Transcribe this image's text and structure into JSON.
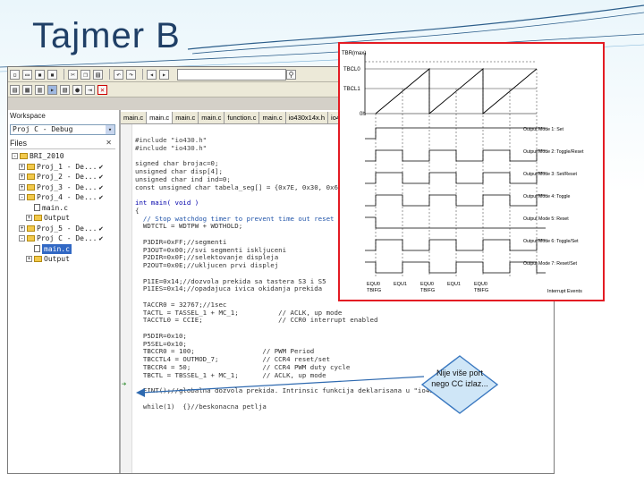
{
  "slide": {
    "title": "Tajmer B"
  },
  "ide": {
    "toolbar1_icons": [
      "new-file-icon",
      "open-icon",
      "save-icon",
      "save-all-icon",
      "cut-icon",
      "copy-icon",
      "paste-icon",
      "undo-icon",
      "redo-icon",
      "find-icon",
      "back-icon",
      "forward-icon"
    ],
    "toolbar2_icons": [
      "compile-icon",
      "make-icon",
      "rebuild-icon",
      "debug-icon",
      "stop-icon"
    ],
    "workspace": {
      "label": "Workspace",
      "config_value": "Proj C - Debug",
      "files_label": "Files",
      "tree": [
        {
          "name": "BRI_2010",
          "indent": 0,
          "type": "folder",
          "check": "",
          "expanded": "-",
          "selected": false
        },
        {
          "name": "Proj_1 - De...",
          "indent": 1,
          "type": "folder",
          "check": "✔",
          "expanded": "+",
          "selected": false
        },
        {
          "name": "Proj_2 - De...",
          "indent": 1,
          "type": "folder",
          "check": "✔",
          "expanded": "+",
          "selected": false
        },
        {
          "name": "Proj_3 - De...",
          "indent": 1,
          "type": "folder",
          "check": "✔",
          "expanded": "+",
          "selected": false
        },
        {
          "name": "Proj_4 - De...",
          "indent": 1,
          "type": "folder",
          "check": "✔",
          "expanded": "-",
          "selected": false
        },
        {
          "name": "main.c",
          "indent": 2,
          "type": "file",
          "check": "",
          "expanded": "",
          "selected": false
        },
        {
          "name": "Output",
          "indent": 2,
          "type": "folder",
          "check": "",
          "expanded": "+",
          "selected": false
        },
        {
          "name": "Proj_5 - De...",
          "indent": 1,
          "type": "folder",
          "check": "✔",
          "expanded": "+",
          "selected": false
        },
        {
          "name": "Proj C - De...",
          "indent": 1,
          "type": "folder",
          "check": "✔",
          "expanded": "-",
          "selected": false
        },
        {
          "name": "main.c",
          "indent": 2,
          "type": "file",
          "check": "",
          "expanded": "",
          "selected": true
        },
        {
          "name": "Output",
          "indent": 2,
          "type": "folder",
          "check": "",
          "expanded": "+",
          "selected": false
        }
      ]
    },
    "tabs": [
      "main.c",
      "main.c",
      "main.c",
      "main.c",
      "function.c",
      "main.c",
      "io430x14x.h",
      "io430x1..."
    ],
    "code": [
      {
        "text": "#include \"io430.h\"",
        "style": "pp"
      },
      {
        "text": "#include \"io430.h\"",
        "style": "pp"
      },
      {
        "text": "",
        "style": ""
      },
      {
        "text": "signed char brojac=0;",
        "style": ""
      },
      {
        "text": "unsigned char disp[4];",
        "style": ""
      },
      {
        "text": "unsigned char ind ind=0;",
        "style": ""
      },
      {
        "text": "const unsigned char tabela_seg[] = {0x7E, 0x30, 0x6D,",
        "style": ""
      },
      {
        "text": "",
        "style": ""
      },
      {
        "text": "int main( void )",
        "style": "kw"
      },
      {
        "text": "{",
        "style": ""
      },
      {
        "text": "  // Stop watchdog timer to prevent time out reset",
        "style": "cmt"
      },
      {
        "text": "  WDTCTL = WDTPW + WDTHOLD;",
        "style": ""
      },
      {
        "text": "",
        "style": ""
      },
      {
        "text": "  P3DIR=0xFF;//segmenti",
        "style": ""
      },
      {
        "text": "  P3OUT=0x00;//svi segmenti iskljuceni",
        "style": ""
      },
      {
        "text": "  P2DIR=0x0F;//selektovanje displeja",
        "style": ""
      },
      {
        "text": "  P2OUT=0x0E;//ukljucen prvi displej",
        "style": ""
      },
      {
        "text": "",
        "style": ""
      },
      {
        "text": "  P1IE=0x14;//dozvola prekida sa tastera S3 i S5",
        "style": ""
      },
      {
        "text": "  P1IES=0x14;//opadajuca ivica okidanja prekida",
        "style": ""
      },
      {
        "text": "",
        "style": ""
      },
      {
        "text": "  TACCR0 = 32767;//1sec",
        "style": ""
      },
      {
        "text": "  TACTL = TASSEL_1 + MC_1;          // ACLK, up mode",
        "style": ""
      },
      {
        "text": "  TACCTL0 = CCIE;                   // CCR0 interrupt enabled",
        "style": ""
      },
      {
        "text": "",
        "style": ""
      },
      {
        "text": "  P5DIR=0x10;",
        "style": ""
      },
      {
        "text": "  P5SEL=0x10;",
        "style": ""
      },
      {
        "text": "  TBCCR0 = 100;                 // PWM Period",
        "style": ""
      },
      {
        "text": "  TBCCTL4 = OUTMOD_7;           // CCR4 reset/set",
        "style": ""
      },
      {
        "text": "  TBCCR4 = 50;                  // CCR4 PWM duty cycle",
        "style": ""
      },
      {
        "text": "  TBCTL = TBSSEL_1 + MC_1;      // ACLK, up mode",
        "style": ""
      },
      {
        "text": "",
        "style": ""
      },
      {
        "text": "  EINT();//globalna dozvola prekida. Intrinsic funkcija deklarisana u \"io430.h\"",
        "style": ""
      },
      {
        "text": "",
        "style": ""
      },
      {
        "text": "  while(1)  {}//beskonacna petlja",
        "style": "hl"
      }
    ]
  },
  "timing_diagram": {
    "y_top_label": "TBR(max)",
    "tbcl0_label": "TBCL0",
    "tbcl1_label": "TBCL1",
    "zero_label": "0h",
    "modes": [
      "Output Mode 1: Set",
      "Output Mode 2: Toggle/Reset",
      "Output Mode 3: Set/Reset",
      "Output Mode 4: Toggle",
      "Output Mode 5: Reset",
      "Output Mode 6: Toggle/Set",
      "Output Mode 7: Reset/Set"
    ],
    "events": [
      "EQU0",
      "TBIFG",
      "EQU1",
      "EQU0",
      "TBIFG",
      "EQU1",
      "EQU0",
      "TBIFG"
    ],
    "events_label": "Interrupt Events"
  },
  "callout": {
    "text": "Nije više port nego CC izlaz..."
  },
  "colors": {
    "title": "#1f3f66",
    "frame": "#e31b23",
    "callout_fill": "#cfe6f7",
    "callout_border": "#3a78c0"
  }
}
